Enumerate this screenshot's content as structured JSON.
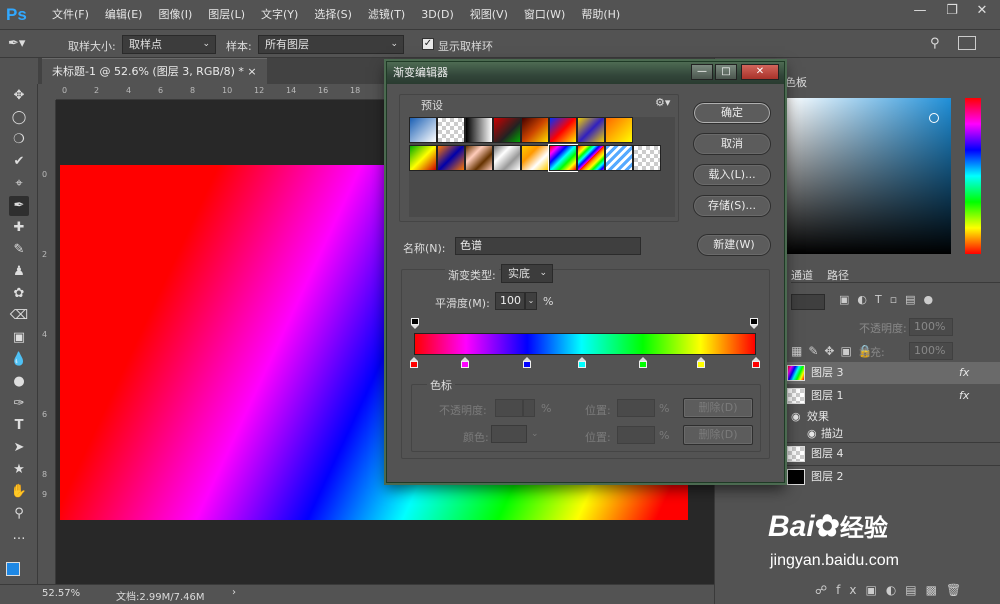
{
  "app": {
    "logo": "Ps"
  },
  "menu": [
    "文件(F)",
    "编辑(E)",
    "图像(I)",
    "图层(L)",
    "文字(Y)",
    "选择(S)",
    "滤镜(T)",
    "3D(D)",
    "视图(V)",
    "窗口(W)",
    "帮助(H)"
  ],
  "options": {
    "sample_size_label": "取样大小:",
    "sample_size_value": "取样点",
    "sample_label": "样本:",
    "sample_value": "所有图层",
    "show_ring_label": "显示取样环"
  },
  "document": {
    "tab_title": "未标题-1 @ 52.6% (图层 3, RGB/8) *"
  },
  "ruler_h": [
    "0",
    "2",
    "4",
    "6",
    "8",
    "10",
    "12",
    "14",
    "16",
    "18"
  ],
  "ruler_v": [
    "0",
    "2",
    "4",
    "6",
    "8",
    "9"
  ],
  "status": {
    "zoom": "52.57%",
    "doc_size": "文档:2.99M/7.46M"
  },
  "dialog": {
    "title": "渐变编辑器",
    "presets_label": "预设",
    "ok": "确定",
    "cancel": "取消",
    "load": "载入(L)...",
    "save": "存储(S)...",
    "name_label": "名称(N):",
    "name_value": "色谱",
    "new": "新建(W)",
    "gradient_type_label": "渐变类型:",
    "gradient_type_value": "实底",
    "smoothness_label": "平滑度(M):",
    "smoothness_value": "100",
    "smoothness_unit": "%",
    "stops_group_label": "色标",
    "opacity_label": "不透明度:",
    "opacity_unit": "%",
    "location_label": "位置:",
    "location_unit": "%",
    "delete_label": "删除(D)",
    "color_label": "颜色:",
    "location2_label": "位置:",
    "location2_unit": "%",
    "delete2_label": "删除(D)",
    "color_stops": [
      "#ff0000",
      "#ff00ff",
      "#0000ff",
      "#00ffff",
      "#00ff00",
      "#ffff00",
      "#ff0000"
    ],
    "color_stop_positions": [
      0,
      15,
      33,
      49,
      67,
      84,
      100
    ]
  },
  "right_panel": {
    "color_tab": "色板",
    "channels_tab": "通道",
    "paths_tab": "路径",
    "opacity_label": "不透明度:",
    "opacity_value": "100%",
    "fill_label": "填充:",
    "fill_value": "100%",
    "layers": [
      {
        "name": "图层 3",
        "fx": "fx"
      },
      {
        "name": "图层 1",
        "fx": "fx"
      },
      {
        "name": "效果"
      },
      {
        "name": "描边"
      },
      {
        "name": "图层 4"
      },
      {
        "name": "图层 2"
      }
    ]
  },
  "watermark": {
    "brand": "Bai",
    "brand2": "经验",
    "url": "jingyan.baidu.com"
  }
}
